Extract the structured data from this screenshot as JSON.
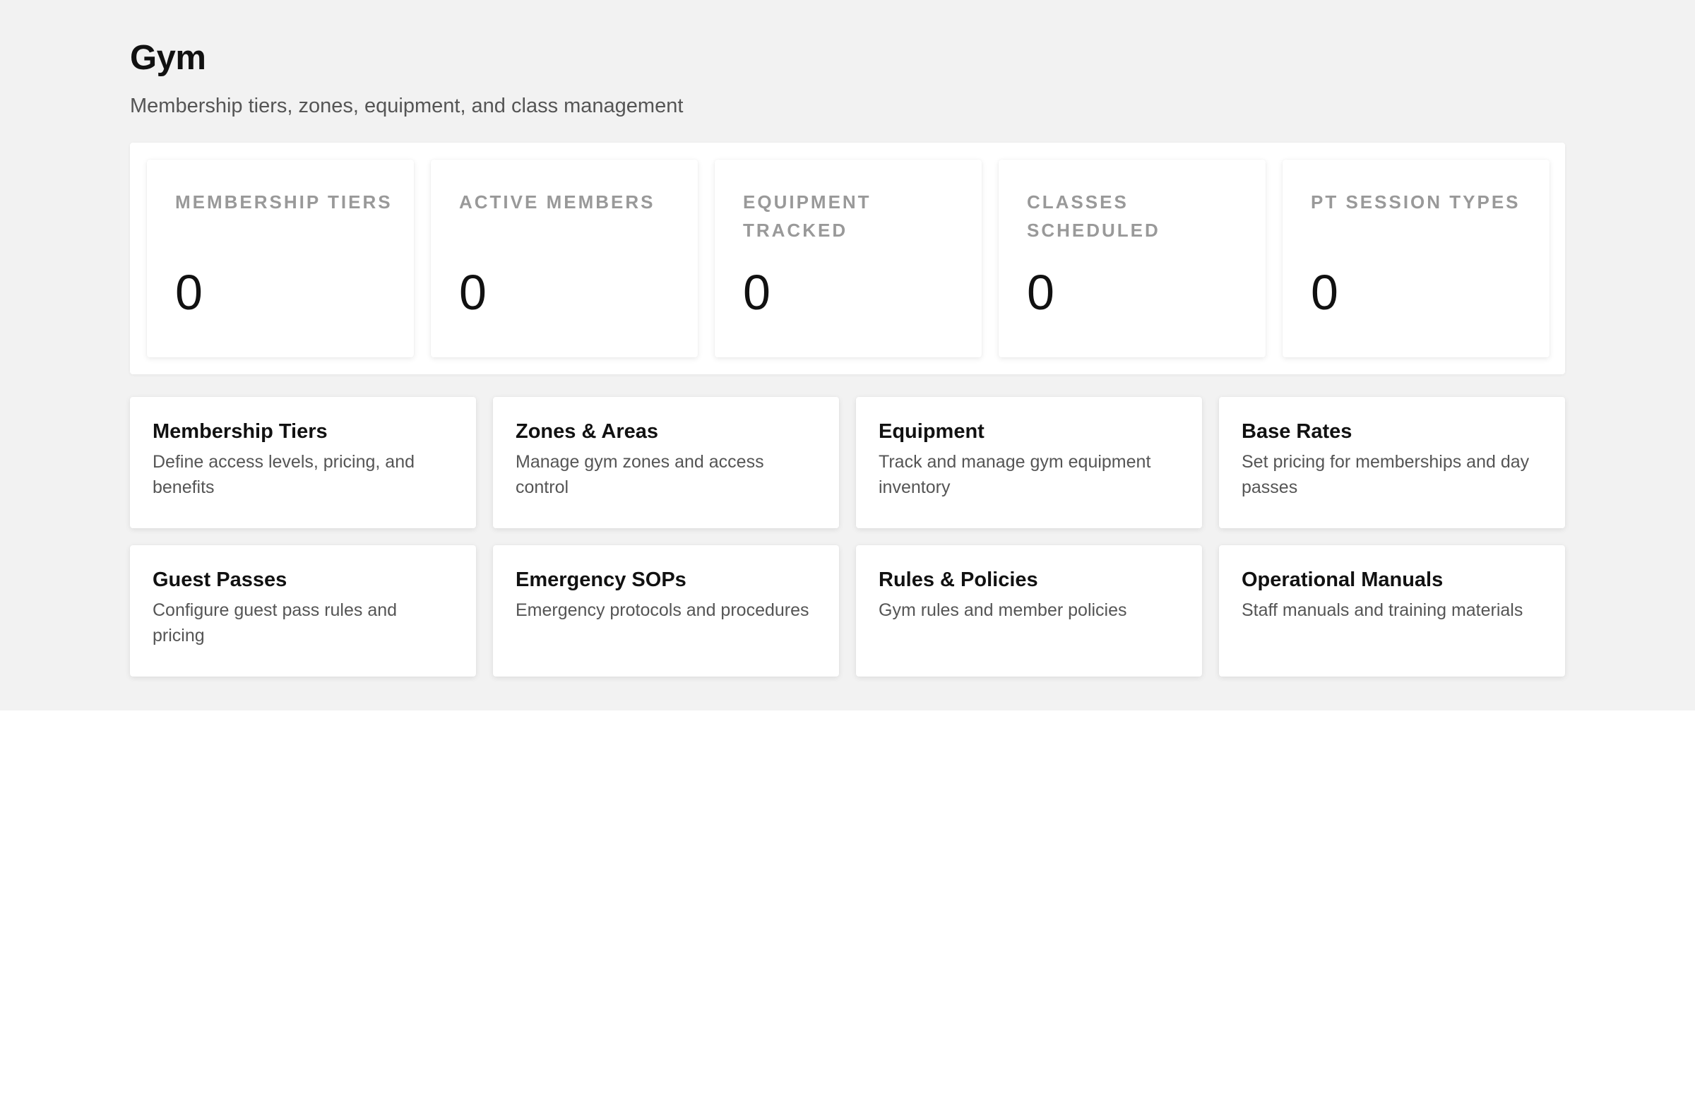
{
  "header": {
    "title": "Gym",
    "subtitle": "Membership tiers, zones, equipment, and class management"
  },
  "stats": [
    {
      "label": "MEMBERSHIP TIERS",
      "value": "0"
    },
    {
      "label": "ACTIVE MEMBERS",
      "value": "0"
    },
    {
      "label": "EQUIPMENT TRACKED",
      "value": "0"
    },
    {
      "label": "CLASSES SCHEDULED",
      "value": "0"
    },
    {
      "label": "PT SESSION TYPES",
      "value": "0"
    }
  ],
  "cards": [
    {
      "title": "Membership Tiers",
      "description": "Define access levels, pricing, and benefits"
    },
    {
      "title": "Zones & Areas",
      "description": "Manage gym zones and access control"
    },
    {
      "title": "Equipment",
      "description": "Track and manage gym equipment inventory"
    },
    {
      "title": "Base Rates",
      "description": "Set pricing for memberships and day passes"
    },
    {
      "title": "Guest Passes",
      "description": "Configure guest pass rules and pricing"
    },
    {
      "title": "Emergency SOPs",
      "description": "Emergency protocols and procedures"
    },
    {
      "title": "Rules & Policies",
      "description": "Gym rules and member policies"
    },
    {
      "title": "Operational Manuals",
      "description": "Staff manuals and training materials"
    }
  ],
  "colors": {
    "page_background": "#f2f2f2",
    "card_background": "#ffffff",
    "label_gray": "#999999",
    "text_dark": "#111111",
    "text_muted": "#555555"
  }
}
